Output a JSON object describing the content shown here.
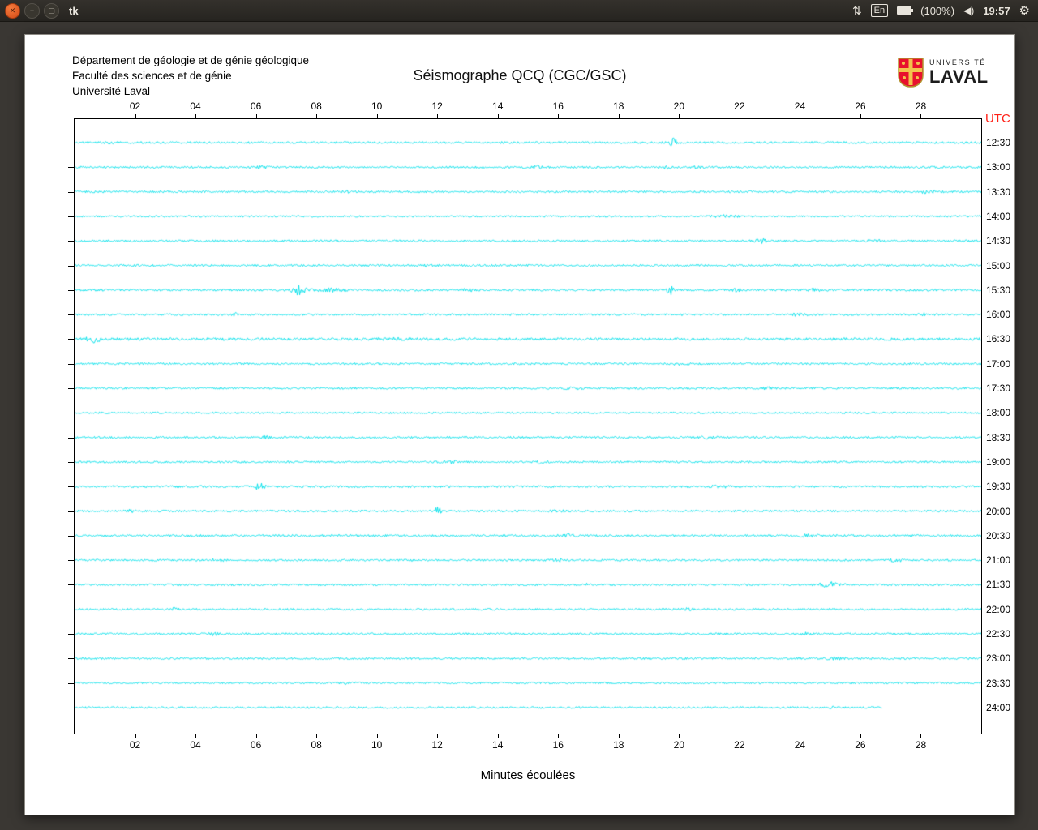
{
  "panel": {
    "window_title": "tk",
    "close_glyph": "✕",
    "minimize_glyph": "−",
    "restore_glyph": "▢",
    "arrows_glyph": "⇅",
    "keyboard_layout": "En",
    "battery_text": "(100%)",
    "speaker_glyph": "◀)",
    "clock": "19:57",
    "gear_glyph": "⚙"
  },
  "header": {
    "department": "Département de géologie et de génie géologique",
    "faculty": "Faculté des sciences et de génie",
    "university": "Université Laval",
    "title": "Séismographe QCQ (CGC/GSC)",
    "logo_top": "UNIVERSITÉ",
    "logo_bottom": "LAVAL"
  },
  "plot": {
    "utc_label": "UTC",
    "utc_color": "#ff2016",
    "trace_color": "#00e0ea",
    "xlabel": "Minutes écoulées",
    "x_ticks": [
      "02",
      "04",
      "06",
      "08",
      "10",
      "12",
      "14",
      "16",
      "18",
      "20",
      "22",
      "24",
      "26",
      "28"
    ],
    "minutes_per_line": 30,
    "traces": [
      {
        "utc": "12:30",
        "end": 30,
        "base": 1.3,
        "events": [
          [
            19.8,
            6,
            0.08
          ],
          [
            1.2,
            0.8,
            0.15
          ]
        ]
      },
      {
        "utc": "13:00",
        "end": 30,
        "base": 1.2,
        "events": [
          [
            6.2,
            1.2,
            0.12
          ],
          [
            15.3,
            1.8,
            0.1
          ],
          [
            19.6,
            2.2,
            0.08
          ],
          [
            20.6,
            1.2,
            0.1
          ]
        ]
      },
      {
        "utc": "13:30",
        "end": 30,
        "base": 1.2,
        "events": [
          [
            9.0,
            0.8,
            0.2
          ],
          [
            28.2,
            1.4,
            0.2
          ]
        ]
      },
      {
        "utc": "14:00",
        "end": 30,
        "base": 1.1,
        "events": [
          [
            21.5,
            1.2,
            0.3
          ]
        ]
      },
      {
        "utc": "14:30",
        "end": 30,
        "base": 1.2,
        "events": [
          [
            22.7,
            2.2,
            0.15
          ],
          [
            26.5,
            1.0,
            0.2
          ]
        ]
      },
      {
        "utc": "15:00",
        "end": 30,
        "base": 1.2,
        "events": [
          [
            11.5,
            0.8,
            0.2
          ]
        ]
      },
      {
        "utc": "15:30",
        "end": 30,
        "base": 1.3,
        "events": [
          [
            7.4,
            5.5,
            0.15
          ],
          [
            8.4,
            1.8,
            0.3
          ],
          [
            13.0,
            2.2,
            0.1
          ],
          [
            19.7,
            6.5,
            0.08
          ],
          [
            21.9,
            1.8,
            0.1
          ],
          [
            24.5,
            1.2,
            0.2
          ]
        ]
      },
      {
        "utc": "16:00",
        "end": 30,
        "base": 1.2,
        "events": [
          [
            5.3,
            1.6,
            0.1
          ],
          [
            24.0,
            1.6,
            0.2
          ],
          [
            28.1,
            1.4,
            0.15
          ]
        ]
      },
      {
        "utc": "16:30",
        "end": 30,
        "base": 1.7,
        "events": [
          [
            0.6,
            4.5,
            0.15
          ],
          [
            10.5,
            0.8,
            0.3
          ]
        ]
      },
      {
        "utc": "17:00",
        "end": 30,
        "base": 1.2,
        "events": [
          [
            20.0,
            0.8,
            0.3
          ]
        ]
      },
      {
        "utc": "17:30",
        "end": 30,
        "base": 1.2,
        "events": [
          [
            16.5,
            1.3,
            0.2
          ],
          [
            23.0,
            1.0,
            0.2
          ]
        ]
      },
      {
        "utc": "18:00",
        "end": 30,
        "base": 1.1,
        "events": []
      },
      {
        "utc": "18:30",
        "end": 30,
        "base": 1.2,
        "events": [
          [
            6.3,
            1.2,
            0.1
          ],
          [
            21.0,
            1.0,
            0.2
          ]
        ]
      },
      {
        "utc": "19:00",
        "end": 30,
        "base": 1.2,
        "events": [
          [
            12.4,
            1.6,
            0.15
          ],
          [
            15.4,
            1.4,
            0.15
          ]
        ]
      },
      {
        "utc": "19:30",
        "end": 30,
        "base": 1.3,
        "events": [
          [
            6.1,
            4.5,
            0.1
          ],
          [
            21.3,
            1.6,
            0.2
          ]
        ]
      },
      {
        "utc": "20:00",
        "end": 30,
        "base": 1.2,
        "events": [
          [
            1.8,
            1.3,
            0.1
          ],
          [
            12.0,
            5.0,
            0.07
          ],
          [
            16.0,
            1.0,
            0.2
          ]
        ]
      },
      {
        "utc": "20:30",
        "end": 30,
        "base": 1.3,
        "events": [
          [
            16.3,
            2.0,
            0.15
          ],
          [
            24.3,
            1.6,
            0.2
          ]
        ]
      },
      {
        "utc": "21:00",
        "end": 30,
        "base": 1.2,
        "events": [
          [
            4.7,
            1.4,
            0.15
          ],
          [
            16.0,
            1.2,
            0.15
          ],
          [
            27.2,
            1.6,
            0.15
          ]
        ]
      },
      {
        "utc": "21:30",
        "end": 30,
        "base": 1.2,
        "events": [
          [
            17.0,
            1.3,
            0.1
          ],
          [
            25.0,
            2.6,
            0.25
          ]
        ]
      },
      {
        "utc": "22:00",
        "end": 30,
        "base": 1.2,
        "events": [
          [
            3.3,
            1.8,
            0.1
          ],
          [
            20.3,
            1.3,
            0.15
          ]
        ]
      },
      {
        "utc": "22:30",
        "end": 30,
        "base": 1.2,
        "events": [
          [
            4.6,
            1.8,
            0.1
          ],
          [
            24.2,
            1.6,
            0.15
          ]
        ]
      },
      {
        "utc": "23:00",
        "end": 30,
        "base": 1.2,
        "events": [
          [
            25.2,
            1.4,
            0.2
          ]
        ]
      },
      {
        "utc": "23:30",
        "end": 30,
        "base": 1.1,
        "events": [
          [
            9.0,
            0.8,
            0.2
          ]
        ]
      },
      {
        "utc": "24:00",
        "end": 26.7,
        "base": 1.2,
        "events": [
          [
            25.0,
            1.3,
            0.1
          ]
        ]
      }
    ]
  }
}
